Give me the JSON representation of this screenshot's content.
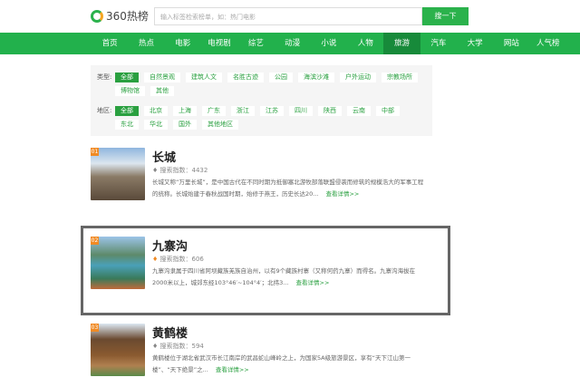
{
  "header": {
    "logo": "360热榜",
    "search_placeholder": "输入标签检索榜单，如：热门电影",
    "search_button": "搜一下"
  },
  "nav": {
    "items": [
      "首页",
      "热点",
      "电影",
      "电视剧",
      "综艺",
      "动漫",
      "小说",
      "人物",
      "旅游",
      "汽车",
      "大学",
      "网站",
      "人气榜"
    ],
    "active": "旅游"
  },
  "filters": {
    "type_label": "类型:",
    "types": [
      "全部",
      "自然景观",
      "建筑人文",
      "名胜古迹",
      "公园",
      "海滨沙滩",
      "户外运动",
      "宗教场所",
      "博物馆",
      "其他"
    ],
    "region_label": "地区:",
    "regions": [
      "全部",
      "北京",
      "上海",
      "广东",
      "浙江",
      "江苏",
      "四川",
      "陕西",
      "云南",
      "中部",
      "东北",
      "华北",
      "国外",
      "其他地区"
    ]
  },
  "list": [
    {
      "rank": "01",
      "title": "长城",
      "count": "搜索指数：4432",
      "desc": "长城又称“万里长城”，是中国古代在不同时期为抵御塞北游牧部落联盟侵袭而修筑的规模浩大的军事工程的统称。长城始建于春秋战国时期，始修于燕王，历史长达20...",
      "more": "查看详情>>"
    },
    {
      "rank": "02",
      "title": "九寨沟",
      "count": "搜索指数：606",
      "desc": "九寨沟隶属于四川省阿坝藏族羌族自治州，以有9个藏族村寨（又称何药九寨）而得名。九寨沟海拔在2000米以上，城郊东经103°46′~104°4′；北纬3...",
      "more": "查看详情>>"
    },
    {
      "rank": "03",
      "title": "黄鹤楼",
      "count": "搜索指数：594",
      "desc": "黄鹤楼位于湖北省武汉市长江南岸的武昌蛇山峰岭之上，为国家5A级旅游景区，享有“天下江山第一楼”、“天下绝景”之...",
      "more": "查看详情>>"
    }
  ],
  "colors": {
    "brand": "#22b14c",
    "nav_active": "#178a3a",
    "rank": "#f08a24"
  }
}
